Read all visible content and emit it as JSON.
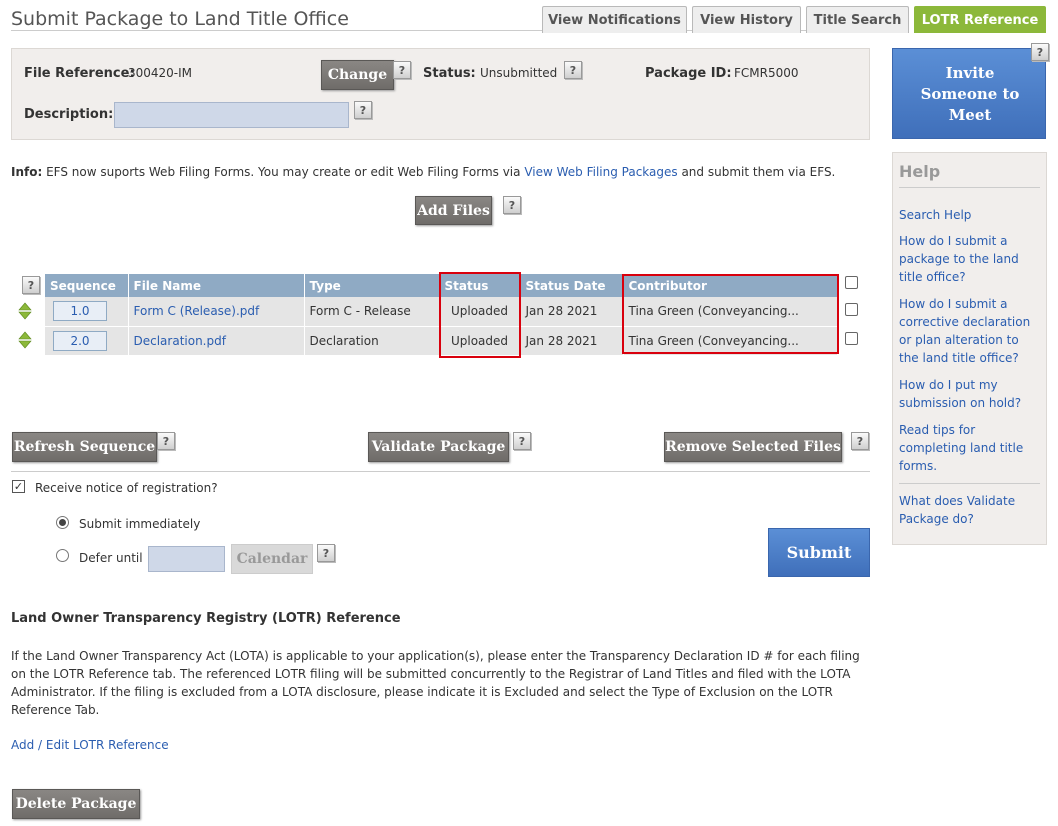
{
  "page": {
    "title": "Submit Package to Land Title Office"
  },
  "tabs": [
    {
      "label": "View Notifications"
    },
    {
      "label": "View History"
    },
    {
      "label": "Title Search"
    },
    {
      "label": "LOTR Reference"
    }
  ],
  "header_panel": {
    "file_reference_label": "File Reference:",
    "file_reference_value": "300420-IM",
    "change_label": "Change",
    "status_label": "Status:",
    "status_value": "Unsubmitted",
    "package_id_label": "Package ID:",
    "package_id_value": "FCMR5000",
    "description_label": "Description:",
    "description_value": ""
  },
  "info": {
    "prefix": "Info:",
    "text1": " EFS now suports Web Filing Forms. You may create or edit Web Filing Forms via ",
    "link": "View Web Filing Packages",
    "text2": " and submit them via EFS."
  },
  "add_files_label": "Add Files",
  "help_glyph": "?",
  "table": {
    "headers": [
      "Sequence",
      "File Name",
      "Type",
      "Status",
      "Status Date",
      "Contributor"
    ],
    "rows": [
      {
        "sequence": "1.0",
        "file_name": "Form C (Release).pdf",
        "type": "Form C - Release",
        "status": "Uploaded",
        "status_date": "Jan 28 2021",
        "contributor": "Tina Green (Conveyancing..."
      },
      {
        "sequence": "2.0",
        "file_name": "Declaration.pdf",
        "type": "Declaration",
        "status": "Uploaded",
        "status_date": "Jan 28 2021",
        "contributor": "Tina Green (Conveyancing..."
      }
    ]
  },
  "actions": {
    "refresh": "Refresh Sequence",
    "validate": "Validate Package",
    "remove": "Remove Selected Files"
  },
  "notice": {
    "receive_label": "Receive notice of registration?",
    "receive_checked": true,
    "submit_immediately": "Submit immediately",
    "defer_until": "Defer until",
    "defer_value": "",
    "calendar": "Calendar",
    "submit": "Submit"
  },
  "lotr": {
    "heading": "Land Owner Transparency Registry (LOTR) Reference",
    "paragraph": "If the Land Owner Transparency Act (LOTA) is applicable to your application(s), please enter the Transparency Declaration ID # for each filing on the LOTR Reference tab. The referenced LOTR filing will be submitted concurrently to the Registrar of Land Titles and filed with the LOTA Administrator. If the filing is excluded from a LOTA disclosure, please indicate it is Excluded and select the Type of Exclusion on the LOTR Reference Tab.",
    "link": "Add / Edit LOTR Reference"
  },
  "delete_label": "Delete Package",
  "invite_label": "Invite Someone to Meet",
  "help": {
    "title": "Help",
    "links": [
      "Search Help",
      "How do I submit a package to the land title office?",
      "How do I submit a corrective declaration or plan alteration to the land title office?",
      "How do I put my submission on hold?",
      "Read tips for completing land title forms.",
      "What does Validate Package do?"
    ]
  },
  "colors": {
    "accent_green": "#8cb83a",
    "header_blue": "#8faac4",
    "button_blue": "#4a7cc7",
    "highlight_red": "#d9000d"
  }
}
